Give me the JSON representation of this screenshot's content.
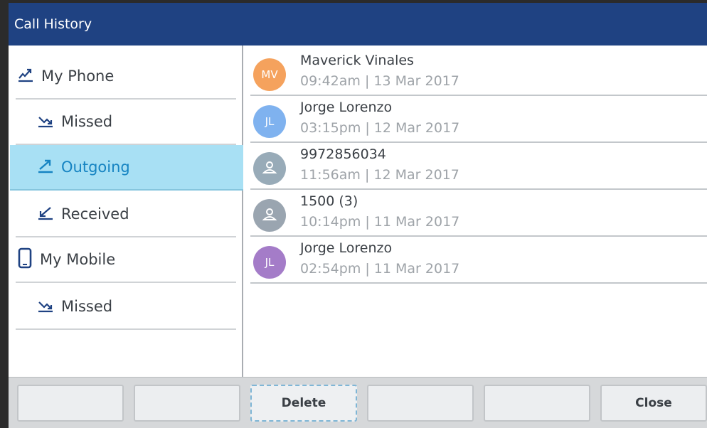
{
  "window": {
    "title": "Call History"
  },
  "sidebar": {
    "items": [
      {
        "label": "My Phone",
        "icon": "handset-icon"
      },
      {
        "label": "Missed",
        "icon": "missed-call-icon"
      },
      {
        "label": "Outgoing",
        "icon": "outgoing-call-icon",
        "selected": true
      },
      {
        "label": "Received",
        "icon": "received-call-icon"
      },
      {
        "label": "My Mobile",
        "icon": "mobile-phone-icon"
      },
      {
        "label": "Missed",
        "icon": "missed-call-icon"
      }
    ]
  },
  "calls": [
    {
      "initials": "MV",
      "name": "Maverick Vinales",
      "time": "09:42am | 13 Mar 2017",
      "color": "#f5a25d"
    },
    {
      "initials": "JL",
      "name": "Jorge Lorenzo",
      "time": "03:15pm | 12 Mar 2017",
      "color": "#7fb2ef"
    },
    {
      "initials": "",
      "name": "9972856034",
      "time": "11:56am | 12 Mar 2017",
      "color": "#98abb8"
    },
    {
      "initials": "",
      "name": "1500 (3)",
      "time": "10:14pm | 11 Mar 2017",
      "color": "#9aa5b0"
    },
    {
      "initials": "JL",
      "name": "Jorge Lorenzo",
      "time": "02:54pm | 11 Mar 2017",
      "color": "#a47cc8"
    }
  ],
  "softkeys": [
    "",
    "",
    "Delete",
    "",
    "",
    "Close"
  ],
  "colors": {
    "titlebar": "#1f4282",
    "selected_bg": "#a8e0f4",
    "selected_text": "#1684c2"
  }
}
